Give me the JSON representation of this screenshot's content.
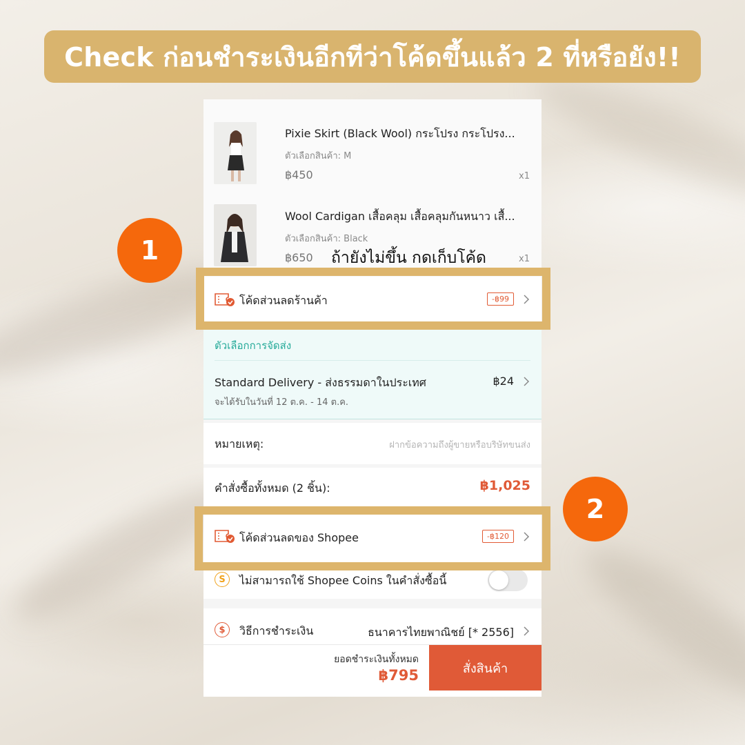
{
  "banner": {
    "title": "Check ก่อนชำระเงินอีกทีว่าโค้ดขึ้นแล้ว 2 ที่หรือยัง!!"
  },
  "annotations": {
    "step1": "1",
    "step2": "2",
    "hint1": "ถ้ายังไม่ขึ้น กดเก็บโค้ด"
  },
  "products": [
    {
      "name": "Pixie Skirt (Black Wool) กระโปรง กระโปรง...",
      "variant": "ตัวเลือกสินค้า: M",
      "price": "฿450",
      "qty": "x1"
    },
    {
      "name": "Wool Cardigan เสื้อคลุม เสื้อคลุมกันหนาว เสื้...",
      "variant": "ตัวเลือกสินค้า: Black",
      "price": "฿650",
      "qty": "x1"
    }
  ],
  "shop_voucher": {
    "label": "โค้ดส่วนลดร้านค้า",
    "tag": "-฿99"
  },
  "shipping": {
    "section_title": "ตัวเลือกการจัดส่ง",
    "method": "Standard Delivery - ส่งธรรมดาในประเทศ",
    "price": "฿24",
    "eta": "จะได้รับในวันที่ 12 ต.ค. - 14 ต.ค."
  },
  "note": {
    "label": "หมายเหตุ:",
    "placeholder": "ฝากข้อความถึงผู้ขายหรือบริษัทขนส่ง"
  },
  "order_total": {
    "label": "คำสั่งซื้อทั้งหมด (2 ชิ้น):",
    "value": "฿1,025"
  },
  "shopee_voucher": {
    "label": "โค้ดส่วนลดของ Shopee",
    "tag": "-฿120"
  },
  "coins": {
    "label": "ไม่สามารถใช้ Shopee Coins ในคำสั่งซื้อนี้",
    "enabled": false
  },
  "payment": {
    "label": "วิธีการชำระเงิน",
    "value": "ธนาคารไทยพาณิชย์ [* 2556]"
  },
  "bottom_bar": {
    "total_label": "ยอดชำระเงินทั้งหมด",
    "total_value": "฿795",
    "order_button": "สั่งสินค้า"
  },
  "colors": {
    "banner": "#d9b46e",
    "accent": "#e05a37",
    "badge": "#f5680c",
    "highlight_box": "#ddb56c",
    "shipping_bg": "#effaf9"
  }
}
